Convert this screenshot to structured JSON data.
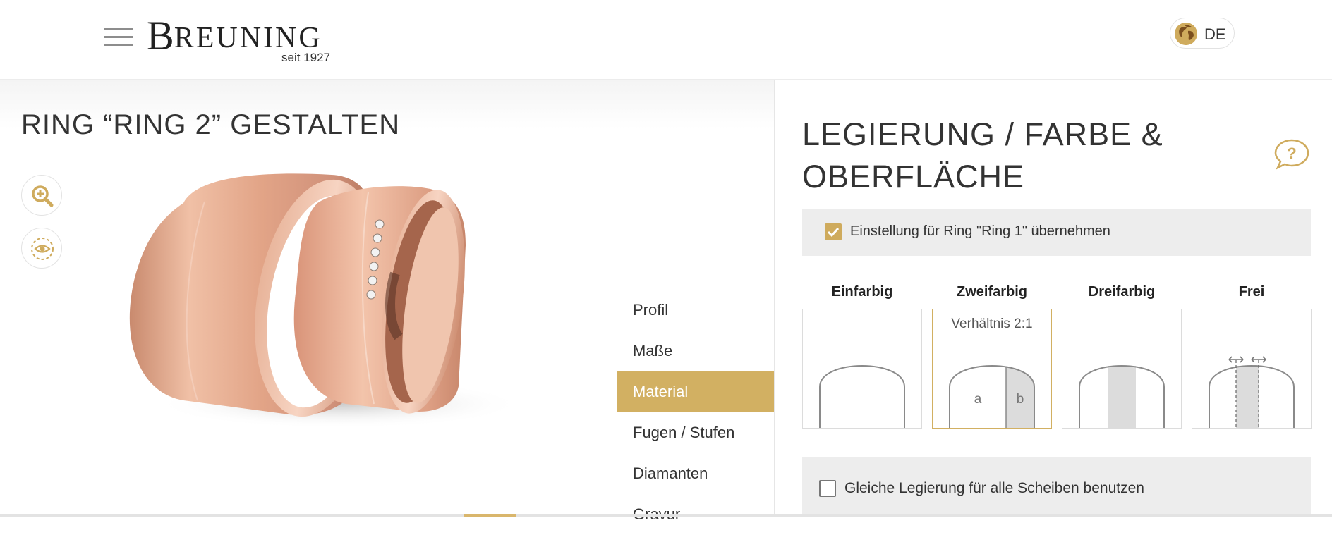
{
  "header": {
    "brand_name": "BREUNING",
    "brand_initial": "B",
    "brand_rest": "REUNING",
    "brand_tagline": "seit 1927",
    "language": "DE"
  },
  "left": {
    "title": "RING “RING 2” GESTALTEN",
    "tools": [
      "zoom-in-icon",
      "eye-icon"
    ]
  },
  "nav": {
    "items": [
      {
        "label": "Profil",
        "active": false
      },
      {
        "label": "Maße",
        "active": false
      },
      {
        "label": "Material",
        "active": true
      },
      {
        "label": "Fugen / Stufen",
        "active": false
      },
      {
        "label": "Diamanten",
        "active": false
      },
      {
        "label": "Gravur",
        "active": false
      }
    ]
  },
  "panel": {
    "title": "LEGIERUNG / FARBE & OBERFLÄCHE",
    "help_icon": "question-bubble-icon",
    "take_setting_label": "Einstellung für Ring \"Ring 1\" übernehmen",
    "take_setting_checked": true,
    "color_options": [
      {
        "label": "Einfarbig",
        "selected": false
      },
      {
        "label": "Zweifarbig",
        "selected": true,
        "ratio": "Verhältnis 2:1",
        "part_a": "a",
        "part_b": "b"
      },
      {
        "label": "Dreifarbig",
        "selected": false
      },
      {
        "label": "Frei",
        "selected": false
      }
    ],
    "same_alloy_label": "Gleiche Legierung für alle Scheiben benutzen",
    "same_alloy_checked": false
  },
  "colors": {
    "accent": "#d2b062",
    "ring_rose_gold": "#d99a80",
    "panel_gray": "#ededed"
  }
}
